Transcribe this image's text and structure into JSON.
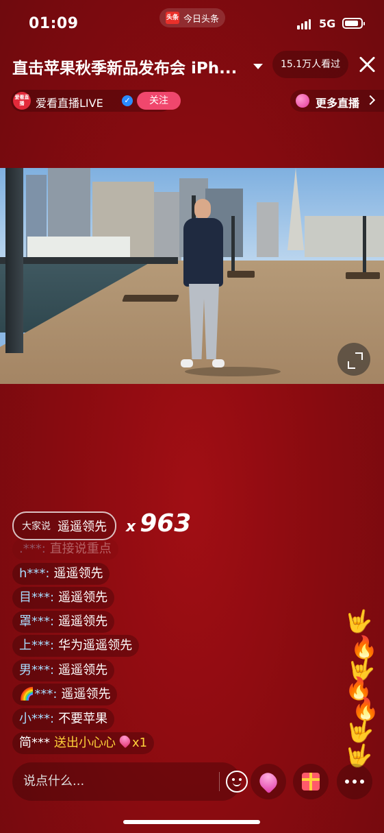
{
  "status_bar": {
    "time": "01:09",
    "app_pill_label": "今日头条",
    "app_pill_logo": "头条",
    "network": "5G",
    "battery_level": 0.85
  },
  "header": {
    "title": "直击苹果秋季新品发布会 iPh...",
    "viewers": "15.1万人看过"
  },
  "channel": {
    "logo_text": "爱看直播",
    "name": "爱看直播LIVE",
    "verified": "✓",
    "follow_label": "关注",
    "more_live_label": "更多直播"
  },
  "combo": {
    "prefix": "大家说",
    "text": "遥遥领先",
    "x": "x",
    "count": "963"
  },
  "comments": [
    {
      "user": ".***:",
      "text": "直接说重点",
      "faded": true
    },
    {
      "user": "h***:",
      "text": "遥遥领先"
    },
    {
      "user": "目***:",
      "text": "遥遥领先"
    },
    {
      "user": "罩***:",
      "text": "遥遥领先"
    },
    {
      "user": "上***:",
      "text": "华为遥遥领先"
    },
    {
      "user": "男***:",
      "text": "遥遥领先"
    },
    {
      "user": "🌈***:",
      "text": "遥遥领先"
    },
    {
      "user": "小***:",
      "text": "不要苹果"
    }
  ],
  "gift_line": {
    "user": "简***",
    "action": "送出小心心",
    "count": "x1"
  },
  "reactions": [
    "🤟",
    "🔥",
    "🤟",
    "🔥",
    "🔥",
    "🤟",
    "🤟"
  ],
  "bottom_bar": {
    "input_placeholder": "说点什么..."
  },
  "icons": {
    "like": "heart-icon",
    "gift": "gift-icon",
    "more": "more-icon",
    "emoji": "emoji-icon",
    "fullscreen": "fullscreen-icon",
    "close": "close-icon"
  },
  "colors": {
    "background": "#8a0b10",
    "follow": "#f0476d",
    "username": "#a9ddff",
    "gift_text": "#ffd23a"
  }
}
